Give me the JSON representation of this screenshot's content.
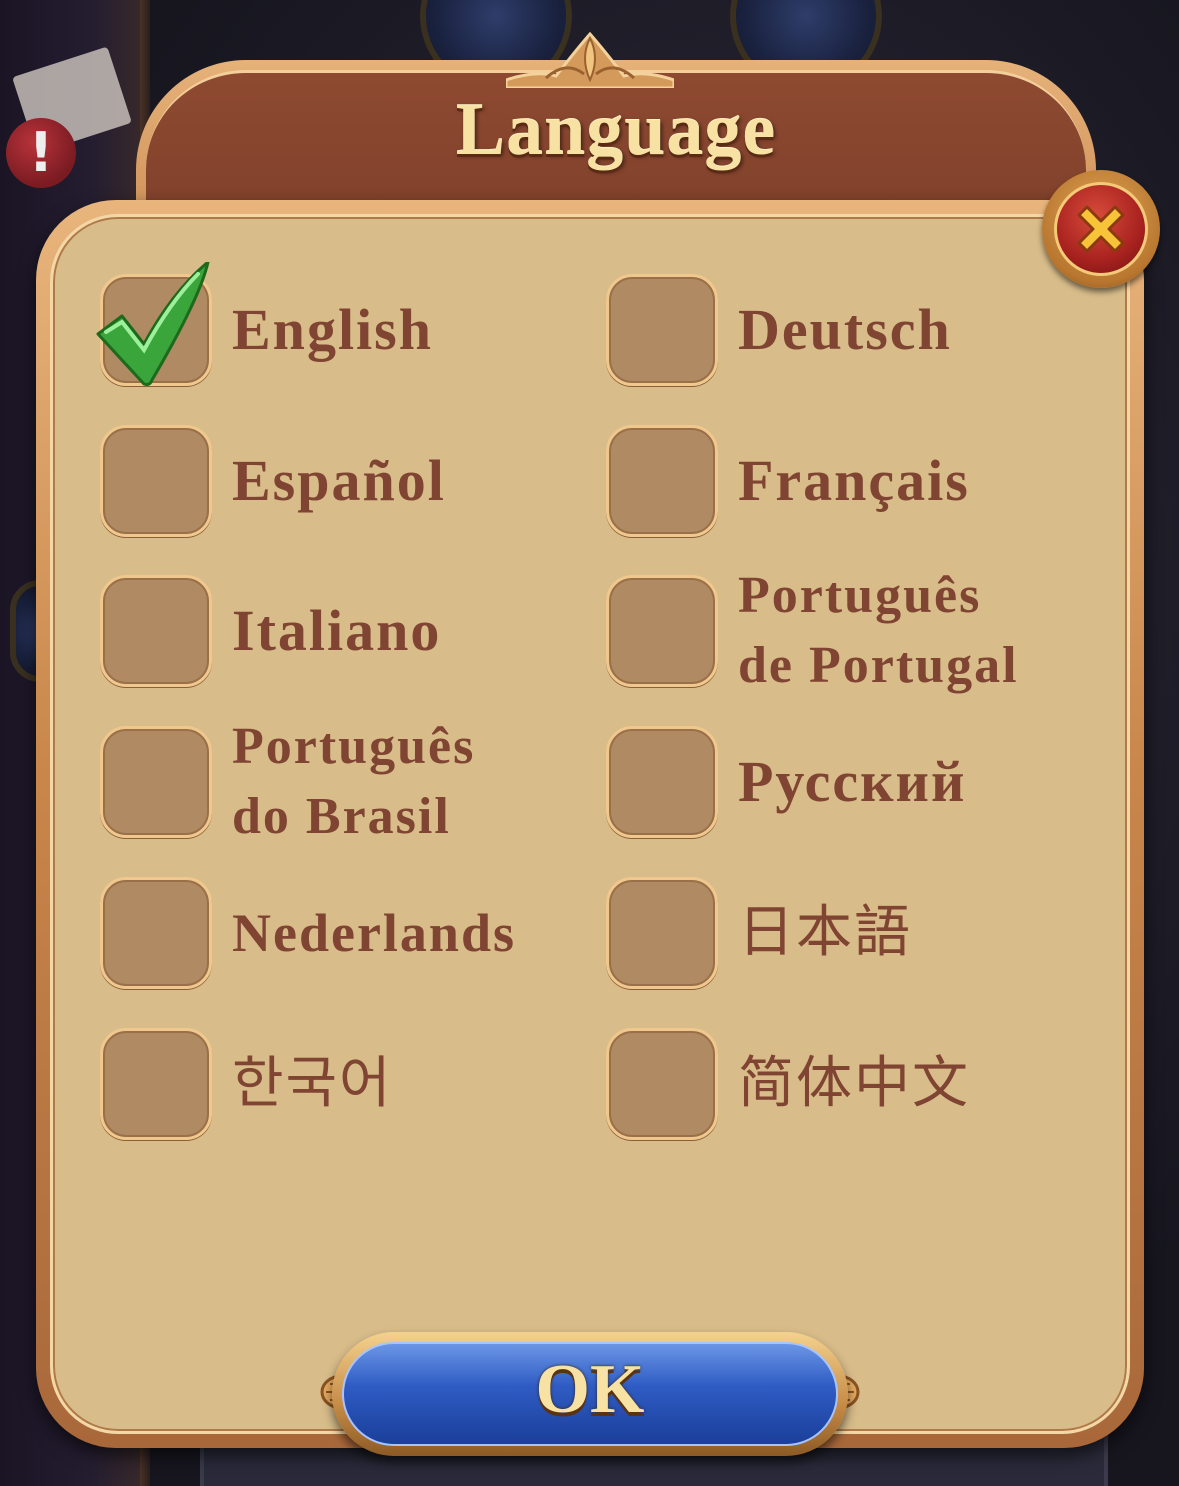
{
  "dialog": {
    "title": "Language",
    "ok_label": "OK"
  },
  "languages": [
    {
      "label": "English",
      "checked": true
    },
    {
      "label": "Deutsch",
      "checked": false
    },
    {
      "label": "Español",
      "checked": false
    },
    {
      "label": "Français",
      "checked": false
    },
    {
      "label": "Italiano",
      "checked": false
    },
    {
      "label": "Português\nde Portugal",
      "checked": false
    },
    {
      "label": "Português\ndo Brasil",
      "checked": false
    },
    {
      "label": "Русский",
      "checked": false
    },
    {
      "label": "Nederlands",
      "checked": false
    },
    {
      "label": "日本語",
      "checked": false
    },
    {
      "label": "한국어",
      "checked": false
    },
    {
      "label": "简体中文",
      "checked": false
    }
  ],
  "icons": {
    "close": "close-x-icon",
    "check": "checkmark-icon"
  },
  "colors": {
    "label_text": "#7f4432",
    "checkbox_fill": "#b08a62",
    "panel": "#d8bc8a",
    "title_bar": "#7a3c28",
    "ok_button": "#2f5cc4",
    "close_button": "#a8221f",
    "check_green": "#3aa53a"
  }
}
